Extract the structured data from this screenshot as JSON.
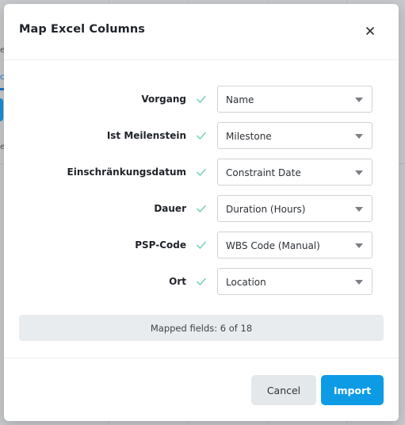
{
  "background": {
    "fragments": [
      "e",
      "c",
      "e"
    ]
  },
  "modal": {
    "title": "Map Excel Columns",
    "close_icon": "close-icon",
    "rows": [
      {
        "label": "Vorgang",
        "value": "Name"
      },
      {
        "label": "Ist Meilenstein",
        "value": "Milestone"
      },
      {
        "label": "Einschränkungsdatum",
        "value": "Constraint Date"
      },
      {
        "label": "Dauer",
        "value": "Duration (Hours)"
      },
      {
        "label": "PSP-Code",
        "value": "WBS Code (Manual)"
      },
      {
        "label": "Ort",
        "value": "Location"
      }
    ],
    "summary": "Mapped fields: 6 of 18",
    "cancel_label": "Cancel",
    "import_label": "Import"
  },
  "colors": {
    "check": "#7fd3b8",
    "primary": "#0d9be6",
    "secondary": "#e5e8eb"
  }
}
